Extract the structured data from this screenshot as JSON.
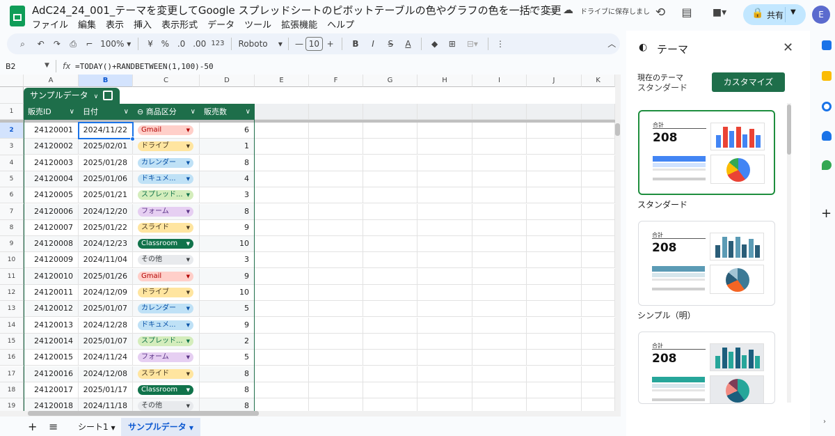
{
  "doc": {
    "title": "AdC24_24_001_テーマを変更してGoogle スプレッドシートのピボットテーブルの色やグラフの色を一括で変更",
    "saved_status": "ドライブに保存しまし",
    "menu": [
      "ファイル",
      "編集",
      "表示",
      "挿入",
      "表示形式",
      "データ",
      "ツール",
      "拡張機能",
      "ヘルプ"
    ],
    "share_label": "共有",
    "avatar_letter": "E"
  },
  "toolbar": {
    "zoom": "100%",
    "currency": "¥",
    "percent": "%",
    "dec_decrease": ".0",
    "dec_increase": ".00",
    "num_format": "123",
    "font": "Roboto",
    "font_size": "10",
    "bold": "B",
    "italic": "I",
    "strike": "S",
    "text_color": "A"
  },
  "formula_bar": {
    "name_box": "B2",
    "fx": "fx",
    "formula": "=TODAY()+RANDBETWEEN(1,100)-50"
  },
  "grid": {
    "columns": [
      "A",
      "B",
      "C",
      "D",
      "E",
      "F",
      "G",
      "H",
      "I",
      "J",
      "K"
    ],
    "selected_col": "B",
    "table_name": "サンプルデータ",
    "headers": [
      "販売ID",
      "日付",
      "商品区分",
      "販売数"
    ],
    "rows": [
      {
        "n": "2",
        "id": "24120001",
        "date": "2024/11/22",
        "cat": "Gmail",
        "qty": "6"
      },
      {
        "n": "3",
        "id": "24120002",
        "date": "2025/02/01",
        "cat": "ドライブ",
        "qty": "1"
      },
      {
        "n": "4",
        "id": "24120003",
        "date": "2025/01/28",
        "cat": "カレンダー",
        "qty": "8"
      },
      {
        "n": "5",
        "id": "24120004",
        "date": "2025/01/06",
        "cat": "ドキュメ...",
        "qty": "4"
      },
      {
        "n": "6",
        "id": "24120005",
        "date": "2025/01/21",
        "cat": "スプレッド...",
        "qty": "3"
      },
      {
        "n": "7",
        "id": "24120006",
        "date": "2024/12/20",
        "cat": "フォーム",
        "qty": "8"
      },
      {
        "n": "8",
        "id": "24120007",
        "date": "2025/01/22",
        "cat": "スライド",
        "qty": "9"
      },
      {
        "n": "9",
        "id": "24120008",
        "date": "2024/12/23",
        "cat": "Classroom",
        "qty": "10"
      },
      {
        "n": "10",
        "id": "24120009",
        "date": "2024/11/04",
        "cat": "その他",
        "qty": "3"
      },
      {
        "n": "11",
        "id": "24120010",
        "date": "2025/01/26",
        "cat": "Gmail",
        "qty": "9"
      },
      {
        "n": "12",
        "id": "24120011",
        "date": "2024/12/09",
        "cat": "ドライブ",
        "qty": "10"
      },
      {
        "n": "13",
        "id": "24120012",
        "date": "2025/01/07",
        "cat": "カレンダー",
        "qty": "5"
      },
      {
        "n": "14",
        "id": "24120013",
        "date": "2024/12/28",
        "cat": "ドキュメ...",
        "qty": "9"
      },
      {
        "n": "15",
        "id": "24120014",
        "date": "2025/01/07",
        "cat": "スプレッド...",
        "qty": "2"
      },
      {
        "n": "16",
        "id": "24120015",
        "date": "2024/11/24",
        "cat": "フォーム",
        "qty": "5"
      },
      {
        "n": "17",
        "id": "24120016",
        "date": "2024/12/08",
        "cat": "スライド",
        "qty": "8"
      },
      {
        "n": "18",
        "id": "24120017",
        "date": "2025/01/17",
        "cat": "Classroom",
        "qty": "8"
      },
      {
        "n": "19",
        "id": "24120018",
        "date": "2024/11/18",
        "cat": "その他",
        "qty": "8"
      }
    ],
    "header_row_number": "1"
  },
  "chip_colors": {
    "Gmail": {
      "bg": "#ffcfc9",
      "fg": "#b10202"
    },
    "ドライブ": {
      "bg": "#ffe5a0",
      "fg": "#473821"
    },
    "カレンダー": {
      "bg": "#bfe1f6",
      "fg": "#0a53a8"
    },
    "ドキュメ...": {
      "bg": "#bfe1f6",
      "fg": "#0a53a8"
    },
    "スプレッド...": {
      "bg": "#d4edbc",
      "fg": "#11734b"
    },
    "フォーム": {
      "bg": "#e6cff2",
      "fg": "#5a3286"
    },
    "スライド": {
      "bg": "#ffe5a0",
      "fg": "#473821"
    },
    "Classroom": {
      "bg": "#11734b",
      "fg": "#ffffff"
    },
    "その他": {
      "bg": "#e8eaed",
      "fg": "#3c4043"
    }
  },
  "sheets": {
    "add": "+",
    "list": "≡",
    "tabs": [
      "シート1",
      "サンプルデータ"
    ],
    "active": "サンプルデータ"
  },
  "theme_panel": {
    "title": "テーマ",
    "current_label": "現在のテーマ",
    "current_value": "スタンダード",
    "customize": "カスタマイズ",
    "themes": [
      {
        "name": "スタンダード",
        "kpi_label": "合計",
        "kpi_value": "208",
        "bar_colors": [
          "#4285f4",
          "#ea4335",
          "#4285f4",
          "#ea4335",
          "#4285f4",
          "#ea4335",
          "#4285f4"
        ],
        "pie": [
          "#4285f4",
          "#ea4335",
          "#fbbc04",
          "#34a853"
        ],
        "band": "#4285f4"
      },
      {
        "name": "シンプル（明）",
        "kpi_label": "合計",
        "kpi_value": "208",
        "bar_colors": [
          "#2a5d78",
          "#5b9bb5",
          "#2a5d78",
          "#5b9bb5",
          "#2a5d78",
          "#5b9bb5",
          "#2a5d78"
        ],
        "pie": [
          "#3d7a96",
          "#f46524",
          "#2a5d78",
          "#a3c4d4"
        ],
        "band": "#5b9bb5"
      },
      {
        "name": "",
        "kpi_label": "合計",
        "kpi_value": "208",
        "bar_colors": [
          "#26a69a",
          "#1b5e7d",
          "#26a69a",
          "#1b5e7d",
          "#26a69a",
          "#1b5e7d",
          "#26a69a"
        ],
        "pie": [
          "#26a69a",
          "#1b5e7d",
          "#f28b82",
          "#7e3d57"
        ],
        "band": "#26a69a"
      }
    ]
  },
  "colors": {
    "table_header": "#1e6e4a",
    "selection": "#1a73e8",
    "share_bg": "#c2e7ff"
  }
}
